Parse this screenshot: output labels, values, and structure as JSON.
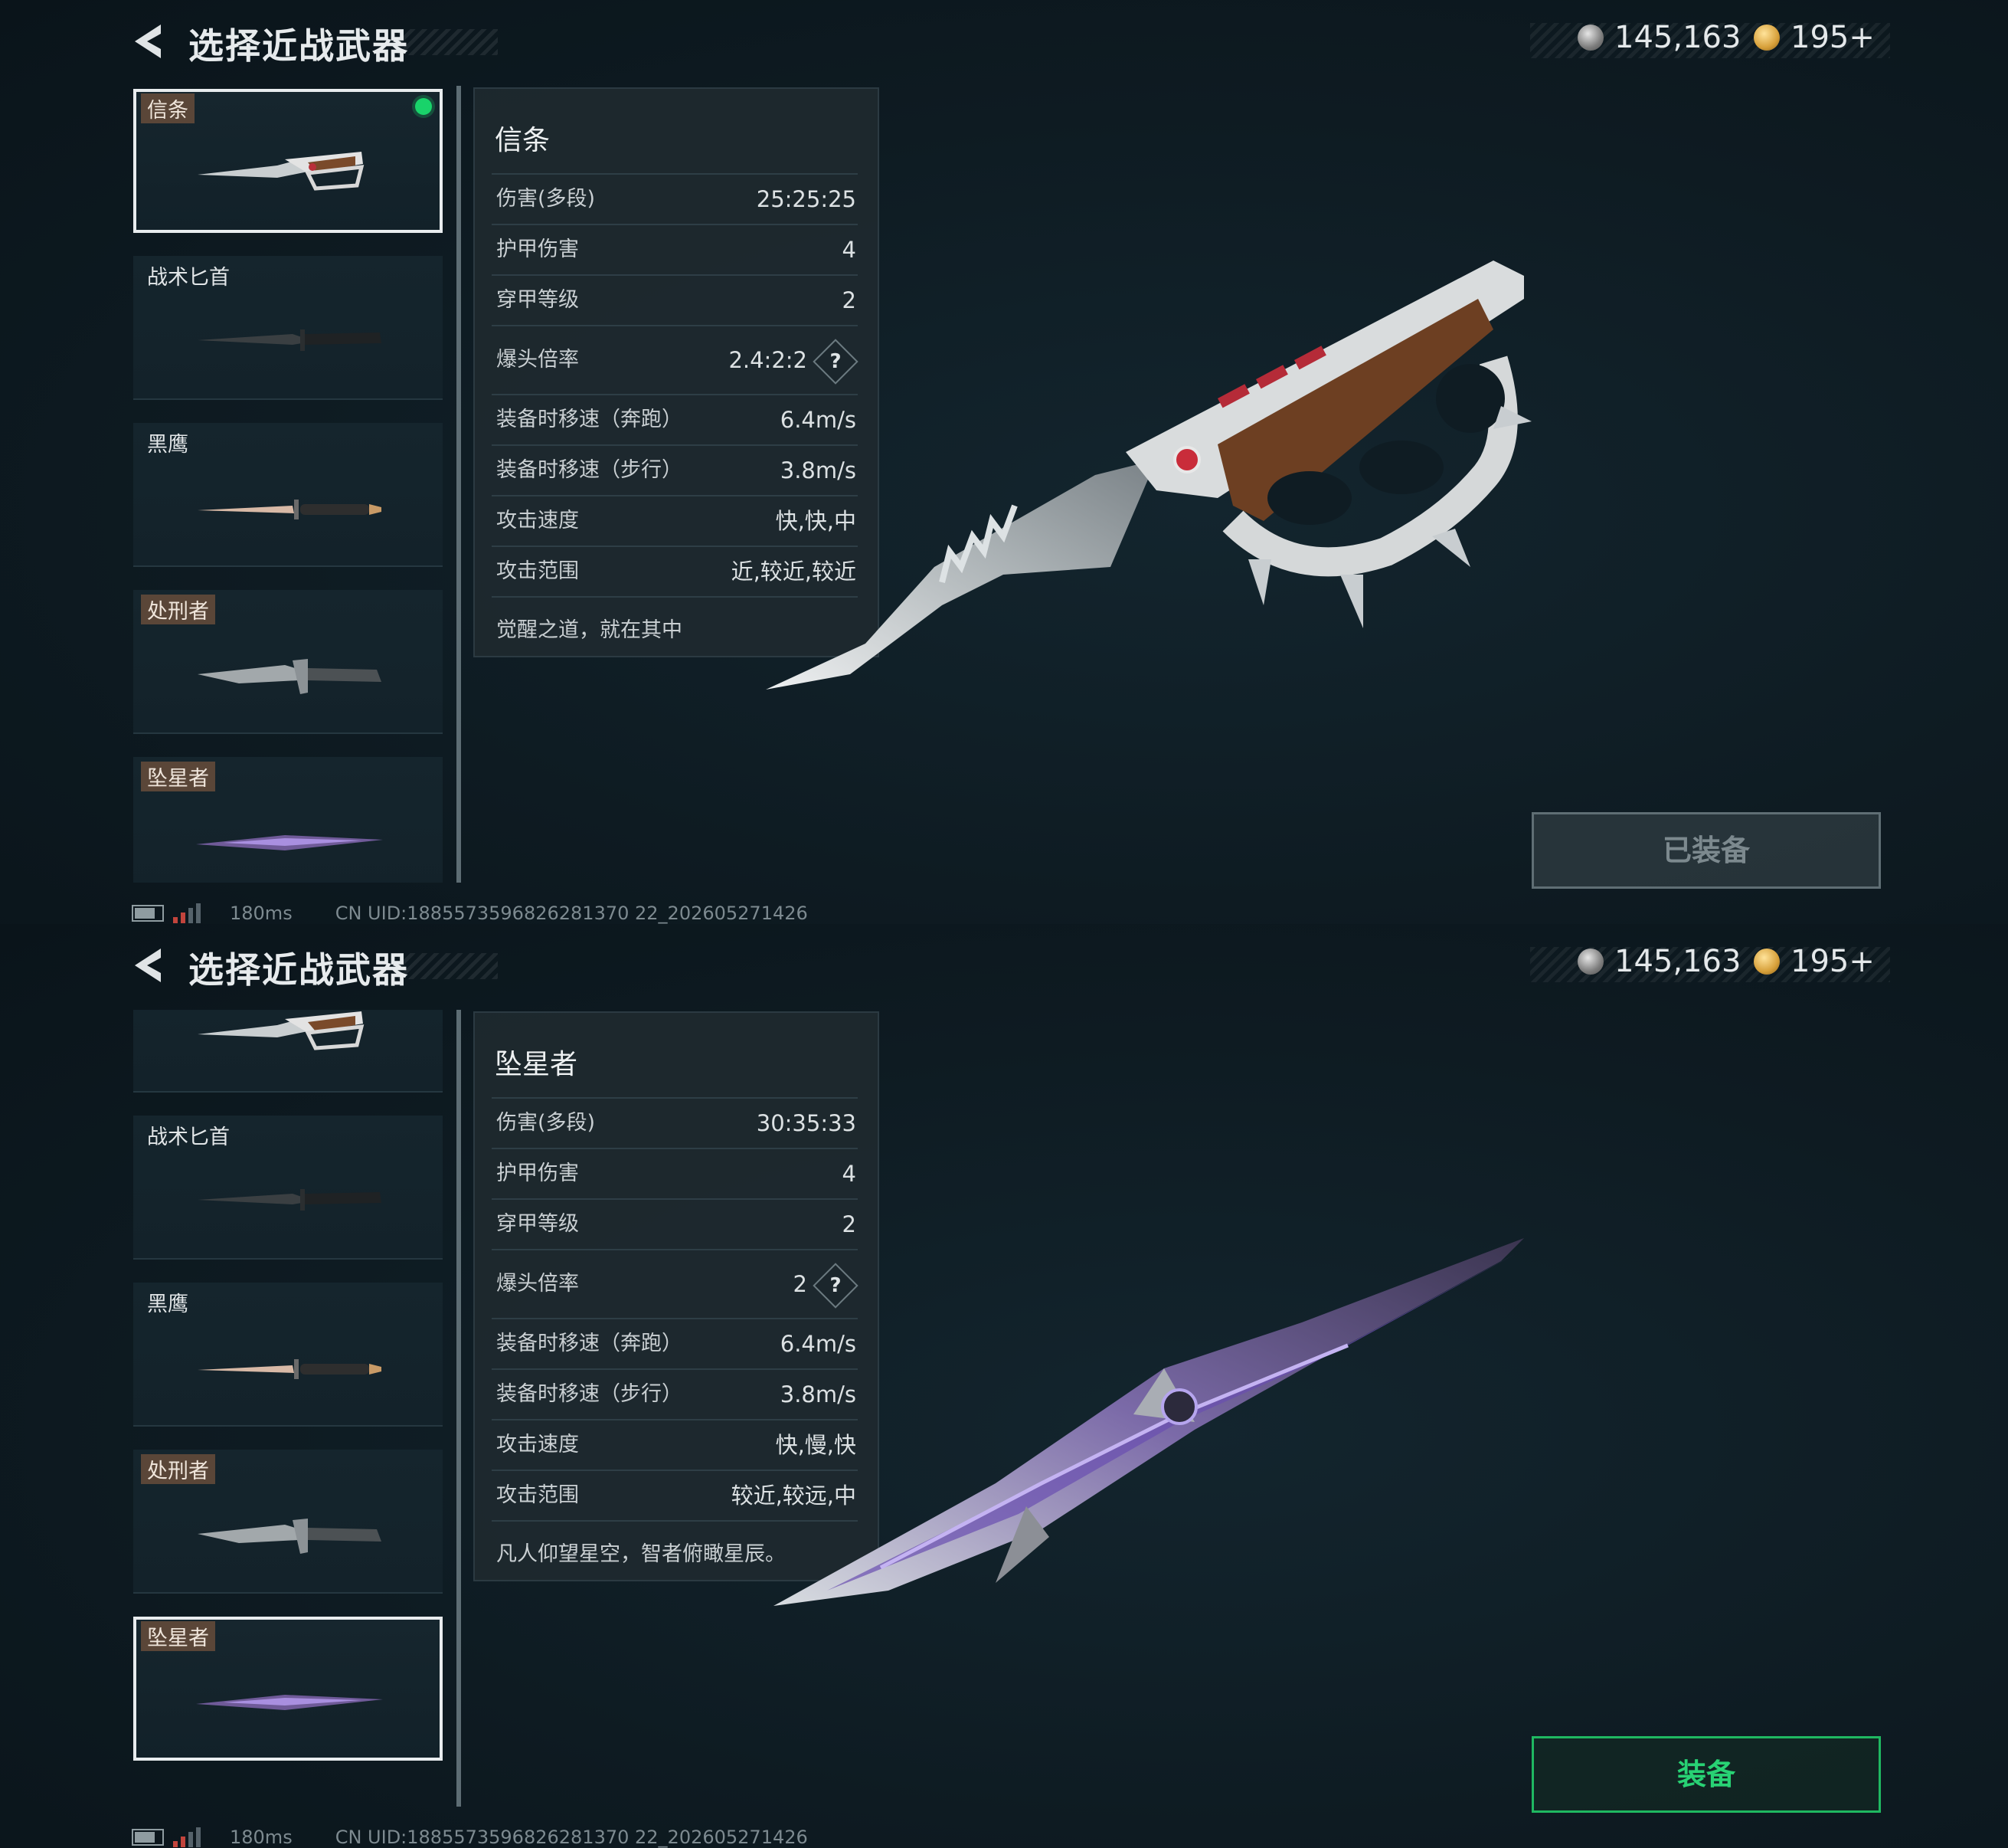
{
  "screens": [
    {
      "header": {
        "title": "选择近战武器"
      },
      "currency": {
        "silver": "145,163",
        "gold": "195+"
      },
      "weapons": [
        {
          "tag": "信条",
          "tag_style": "hl",
          "selected": true,
          "equipped": true
        },
        {
          "tag": "战术匕首",
          "tag_style": "plain"
        },
        {
          "tag": "黑鹰",
          "tag_style": "plain"
        },
        {
          "tag": "处刑者",
          "tag_style": "hl"
        },
        {
          "tag": "坠星者",
          "tag_style": "hl"
        }
      ],
      "details": {
        "name": "信条",
        "stats": [
          {
            "label": "伤害(多段)",
            "value": "25:25:25"
          },
          {
            "label": "护甲伤害",
            "value": "4"
          },
          {
            "label": "穿甲等级",
            "value": "2"
          },
          {
            "label": "爆头倍率",
            "value": "2.4:2:2",
            "help": "?"
          },
          {
            "label": "装备时移速（奔跑）",
            "value": "6.4m/s"
          },
          {
            "label": "装备时移速（步行）",
            "value": "3.8m/s"
          },
          {
            "label": "攻击速度",
            "value": "快,快,中"
          },
          {
            "label": "攻击范围",
            "value": "近,较近,较近"
          }
        ],
        "quote": "觉醒之道，就在其中"
      },
      "action_button": {
        "label": "已装备",
        "state": "equipped"
      },
      "status": {
        "ping": "180ms",
        "uid": "CN UID:1885573596826281370 22_202605271426"
      }
    },
    {
      "header": {
        "title": "选择近战武器"
      },
      "currency": {
        "silver": "145,163",
        "gold": "195+"
      },
      "weapons": [
        {
          "tag": "",
          "tag_style": "none"
        },
        {
          "tag": "战术匕首",
          "tag_style": "plain"
        },
        {
          "tag": "黑鹰",
          "tag_style": "plain"
        },
        {
          "tag": "处刑者",
          "tag_style": "hl"
        },
        {
          "tag": "坠星者",
          "tag_style": "hl",
          "selected": true
        }
      ],
      "details": {
        "name": "坠星者",
        "stats": [
          {
            "label": "伤害(多段)",
            "value": "30:35:33"
          },
          {
            "label": "护甲伤害",
            "value": "4"
          },
          {
            "label": "穿甲等级",
            "value": "2"
          },
          {
            "label": "爆头倍率",
            "value": "2",
            "help": "?"
          },
          {
            "label": "装备时移速（奔跑）",
            "value": "6.4m/s"
          },
          {
            "label": "装备时移速（步行）",
            "value": "3.8m/s"
          },
          {
            "label": "攻击速度",
            "value": "快,慢,快"
          },
          {
            "label": "攻击范围",
            "value": "较近,较远,中"
          }
        ],
        "quote": "凡人仰望星空，智者俯瞰星辰。"
      },
      "action_button": {
        "label": "装备",
        "state": "available"
      },
      "status": {
        "ping": "180ms",
        "uid": "CN UID:1885573596826281370 22_202605271426"
      }
    }
  ],
  "colors": {
    "background": "#0d1a21",
    "selected_indicator": "#19d36a",
    "equip_active": "#28d274",
    "equipped_disabled": "#7c898e",
    "tag_highlight": "#5a4638"
  },
  "icons": [
    "back-arrow-icon",
    "silver-coin-icon",
    "gold-coin-icon",
    "equipped-dot-icon",
    "help-icon",
    "battery-icon",
    "signal-icon"
  ]
}
